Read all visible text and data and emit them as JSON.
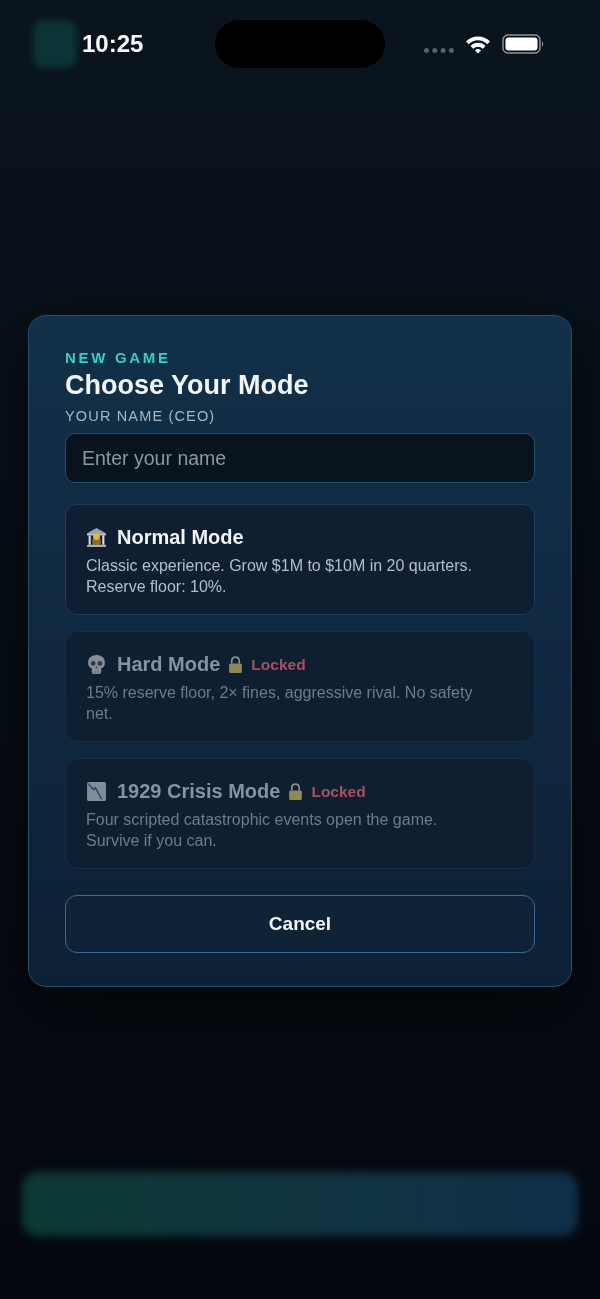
{
  "status_bar": {
    "time": "10:25"
  },
  "modal": {
    "eyebrow": "NEW GAME",
    "title": "Choose Your Mode",
    "name_field": {
      "label": "YOUR NAME (CEO)",
      "placeholder": "Enter your name"
    },
    "modes": [
      {
        "kind": "normal",
        "title": "Normal Mode",
        "locked": false,
        "description": "Classic experience. Grow $1M to $10M in 20 quarters. Reserve floor: 10%."
      },
      {
        "kind": "hard",
        "title": "Hard Mode",
        "locked": true,
        "status": "Locked",
        "description": "15% reserve floor, 2× fines, aggressive rival. No safety net."
      },
      {
        "kind": "crisis",
        "title": "1929 Crisis Mode",
        "locked": true,
        "status": "Locked",
        "description": "Four scripted catastrophic events open the game. Survive if you can."
      }
    ],
    "cancel_button": "Cancel"
  }
}
